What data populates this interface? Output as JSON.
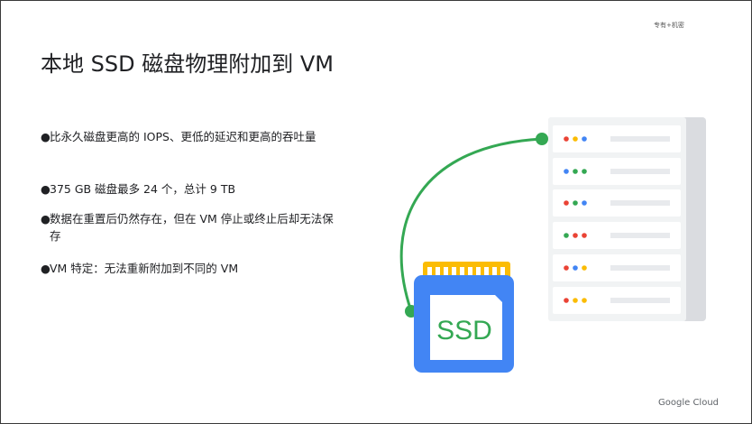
{
  "confidential": "专有+机密",
  "title": "本地 SSD 磁盘物理附加到 VM",
  "bullets": [
    "比永久磁盘更高的 IOPS、更低的延迟和更高的吞吐量",
    "375 GB 磁盘最多 24 个，总计 9 TB",
    "数据在重置后仍然存在，但在 VM 停止或终止后却无法保存",
    "VM 特定：无法重新附加到不同的 VM"
  ],
  "bullet_symbol": "●",
  "ssd_label": "SSD",
  "brand": "Google Cloud",
  "colors": {
    "green": "#34a853",
    "blue": "#4285f4",
    "red": "#ea4335",
    "yellow": "#fbbc04",
    "server_bg": "#f1f3f4"
  },
  "server_rows": [
    [
      "red",
      "yellow",
      "blue"
    ],
    [
      "blue",
      "green",
      "green"
    ],
    [
      "red",
      "green",
      "blue"
    ],
    [
      "green",
      "red",
      "red"
    ],
    [
      "red",
      "blue",
      "yellow"
    ],
    [
      "red",
      "yellow",
      "yellow"
    ]
  ]
}
